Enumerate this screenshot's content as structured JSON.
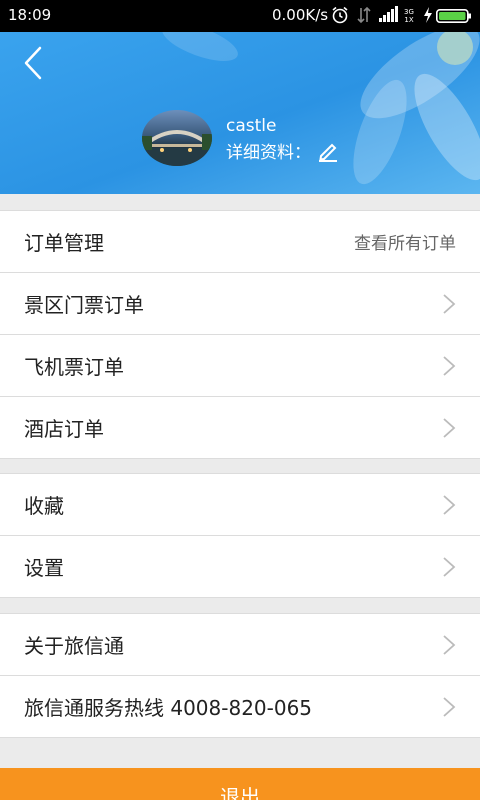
{
  "status_bar": {
    "time": "18:09",
    "speed": "0.00K/s",
    "net_type": "3G 1X",
    "battery_color": "#5ad146"
  },
  "header": {
    "username": "castle",
    "detail_label": "详细资料：",
    "bg_color": "#2b93e3"
  },
  "orders": {
    "title": "订单管理",
    "view_all": "查看所有订单",
    "items": [
      {
        "label": "景区门票订单"
      },
      {
        "label": "飞机票订单"
      },
      {
        "label": "酒店订单"
      }
    ]
  },
  "misc": {
    "items": [
      {
        "label": "收藏"
      },
      {
        "label": "设置"
      }
    ]
  },
  "about": {
    "items": [
      {
        "label": "关于旅信通"
      },
      {
        "label": "旅信通服务热线 4008-820-065"
      }
    ]
  },
  "logout_label": "退出",
  "accent_color": "#f7931e"
}
